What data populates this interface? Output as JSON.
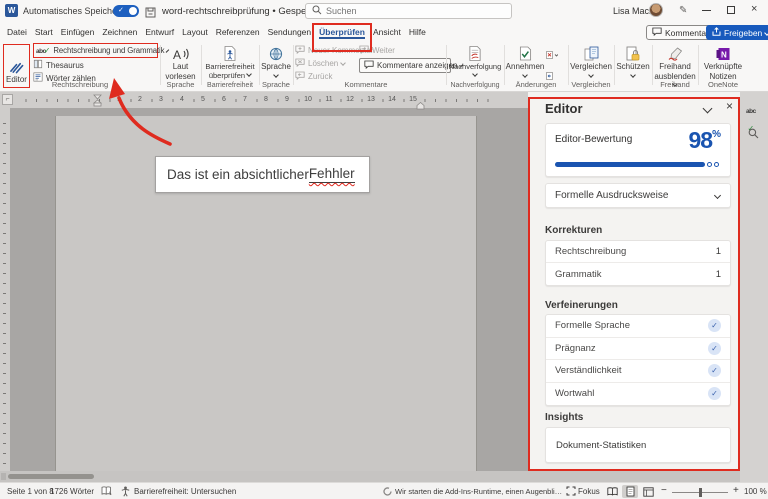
{
  "colors": {
    "annotation_red": "#df2b1f",
    "word_blue": "#2b579a",
    "share_blue": "#185abd",
    "score_blue": "#1a54b0"
  },
  "title_bar": {
    "autosave_label": "Automatisches Speichern",
    "file_name": "word-rechtschreibprüfung",
    "file_status": "Gespeichert",
    "search_placeholder": "Suchen",
    "user_name": "Lisa Mack"
  },
  "tab_bar": {
    "tabs": [
      "Datei",
      "Start",
      "Einfügen",
      "Zeichnen",
      "Entwurf",
      "Layout",
      "Referenzen",
      "Sendungen",
      "Überprüfen",
      "Ansicht",
      "Hilfe"
    ],
    "selected_tab": "Überprüfen",
    "comments_button": "Kommentare",
    "share_button": "Freigeben"
  },
  "ribbon": {
    "proofing": {
      "editor": "Editor",
      "spelling_grammar": "Rechtschreibung und Grammatik",
      "thesaurus": "Thesaurus",
      "word_count": "Wörter zählen",
      "group_label": "Rechtschreibung"
    },
    "speech": {
      "read_aloud_line1": "Laut",
      "read_aloud_line2": "vorlesen",
      "group_label": "Sprache"
    },
    "accessibility": {
      "check_line1": "Barrierefreiheit",
      "check_line2": "überprüfen",
      "group_label": "Barrierefreiheit"
    },
    "language": {
      "button": "Sprache",
      "group_label": "Sprache"
    },
    "comments": {
      "new_comment": "Neuer Kommentar",
      "delete": "Löschen",
      "previous": "Zurück",
      "next": "Weiter",
      "show_comments": "Kommentare anzeigen",
      "group_label": "Kommentare"
    },
    "tracking": {
      "button": "Nachverfolgung",
      "group_label": "Nachverfolgung"
    },
    "changes": {
      "accept": "Annehmen",
      "group_label": "Änderungen"
    },
    "compare": {
      "button": "Vergleichen",
      "group_label": "Vergleichen"
    },
    "protect": {
      "button": "Schützen"
    },
    "ink": {
      "line1": "Freihand",
      "line2": "ausblenden",
      "group_label": "Freihand"
    },
    "onenote": {
      "line1": "Verknüpfte",
      "line2": "Notizen",
      "group_label": "OneNote"
    }
  },
  "ruler": {
    "numbers": [
      "1",
      "2",
      "3",
      "4",
      "5",
      "6",
      "7",
      "8",
      "9",
      "10",
      "11",
      "12",
      "13",
      "14",
      "15"
    ]
  },
  "document": {
    "sentence_prefix": "Das ist ein absichtlicher ",
    "misspelled_word": "Fehhler"
  },
  "editor_pane": {
    "title": "Editor",
    "score_label": "Editor-Bewertung",
    "score_value": "98",
    "score_unit": "%",
    "tone_selector": "Formelle Ausdrucksweise",
    "corrections": {
      "heading": "Korrekturen",
      "items": [
        {
          "label": "Rechtschreibung",
          "count": "1"
        },
        {
          "label": "Grammatik",
          "count": "1"
        }
      ]
    },
    "refinements": {
      "heading": "Verfeinerungen",
      "items": [
        {
          "label": "Formelle Sprache"
        },
        {
          "label": "Prägnanz"
        },
        {
          "label": "Verständlichkeit"
        },
        {
          "label": "Wortwahl"
        }
      ]
    },
    "insights": {
      "heading": "Insights",
      "items": [
        {
          "label": "Dokument-Statistiken"
        }
      ]
    }
  },
  "status_bar": {
    "page_indicator": "Seite 1 von 8",
    "word_count": "1726 Wörter",
    "accessibility": "Barrierefreiheit: Untersuchen",
    "addin_message": "Wir starten die Add-Ins-Runtime, einen Augenblick bitte...",
    "focus": "Fokus",
    "zoom_level": "100 %"
  }
}
